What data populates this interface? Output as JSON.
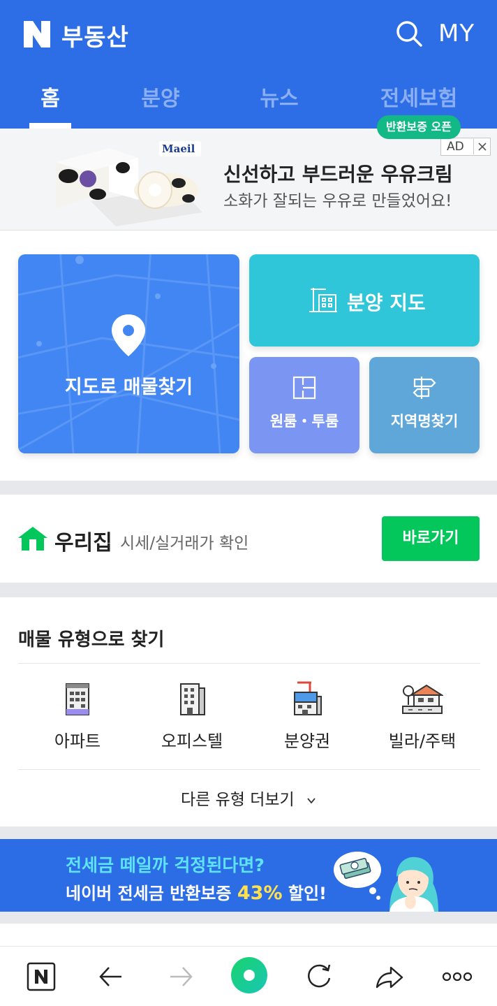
{
  "header": {
    "brand": "부동산",
    "my_label": "MY",
    "tabs": [
      {
        "label": "홈",
        "active": true
      },
      {
        "label": "분양",
        "active": false
      },
      {
        "label": "뉴스",
        "active": false
      },
      {
        "label": "전세보험",
        "active": false
      }
    ],
    "tab_badge": "반환보증 오픈"
  },
  "ad": {
    "title": "신선하고 부드러운 우유크림",
    "subtitle": "소화가 잘되는 우유로 만들었어요!",
    "mark": "AD",
    "brand_logo": "Maeil"
  },
  "quick_menu": {
    "map_search": "지도로 매물찾기",
    "bunyang_map": "분양 지도",
    "oneroom": "원룸・투룸",
    "region_search": "지역명찾기"
  },
  "our_house": {
    "title": "우리집",
    "subtitle": "시세/실거래가 확인",
    "button": "바로가기"
  },
  "property_types": {
    "title": "매물 유형으로 찾기",
    "items": [
      {
        "label": "아파트",
        "icon": "apartment-icon"
      },
      {
        "label": "오피스텔",
        "icon": "officetel-icon"
      },
      {
        "label": "분양권",
        "icon": "presale-icon"
      },
      {
        "label": "빌라/주택",
        "icon": "villa-icon"
      }
    ],
    "more": "다른 유형 더보기"
  },
  "banner": {
    "line1": "전세금 떼일까 걱정된다면?",
    "line2_prefix": "네이버 전세금 반환보증 ",
    "line2_pct": "43%",
    "line2_suffix": " 할인!"
  },
  "colors": {
    "header_blue": "#2d6ee6",
    "naver_green": "#03c75a",
    "badge_green": "#12b886"
  }
}
